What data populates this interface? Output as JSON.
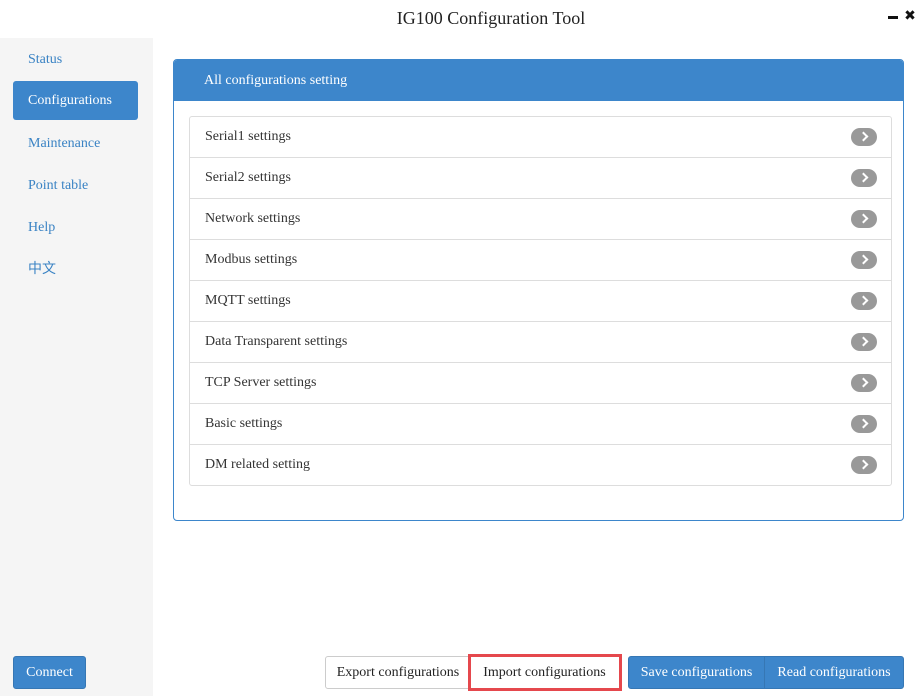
{
  "window": {
    "title": "IG100 Configuration Tool",
    "minimize_icon": "minimize-icon",
    "close_icon": "close-icon",
    "close_glyph": "✖"
  },
  "sidebar": {
    "items": [
      {
        "label": "Status",
        "active": false
      },
      {
        "label": "Configurations",
        "active": true
      },
      {
        "label": "Maintenance",
        "active": false
      },
      {
        "label": "Point table",
        "active": false
      },
      {
        "label": "Help",
        "active": false
      },
      {
        "label": "中文",
        "active": false
      }
    ],
    "connect_label": "Connect"
  },
  "panel": {
    "header": "All configurations setting",
    "items": [
      {
        "label": "Serial1 settings",
        "icon": "chevron-right-icon"
      },
      {
        "label": "Serial2 settings",
        "icon": "chevron-right-icon"
      },
      {
        "label": "Network settings",
        "icon": "chevron-right-icon"
      },
      {
        "label": "Modbus settings",
        "icon": "chevron-right-icon"
      },
      {
        "label": "MQTT settings",
        "icon": "chevron-right-icon"
      },
      {
        "label": "Data Transparent settings",
        "icon": "chevron-right-icon"
      },
      {
        "label": "TCP Server settings",
        "icon": "chevron-right-icon"
      },
      {
        "label": "Basic settings",
        "icon": "chevron-right-icon"
      },
      {
        "label": "DM related setting",
        "icon": "chevron-right-icon"
      }
    ]
  },
  "actions": {
    "export_label": "Export configurations",
    "import_label": "Import configurations",
    "save_label": "Save configurations",
    "read_label": "Read configurations"
  },
  "colors": {
    "accent": "#3d86cb",
    "highlight": "#e5484d",
    "chevron": "#999999",
    "sidebar_bg": "#f5f5f5"
  }
}
